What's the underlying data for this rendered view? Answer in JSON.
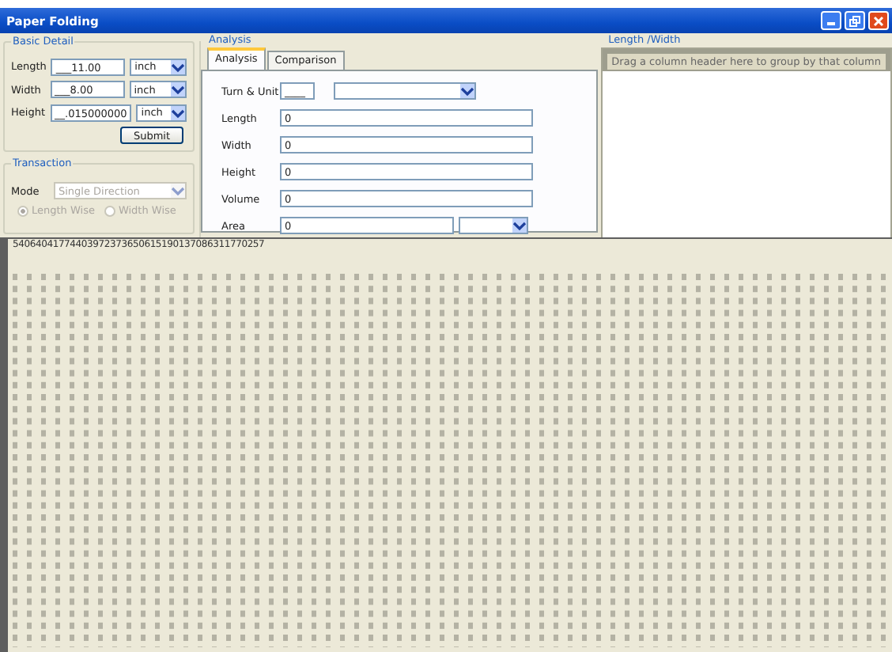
{
  "window": {
    "title": "Paper Folding"
  },
  "basic_detail": {
    "title": "Basic Detail",
    "fields": [
      {
        "label": "Length",
        "value": "___11.00",
        "unit": "inch"
      },
      {
        "label": "Width",
        "value": "___8.00",
        "unit": "inch"
      },
      {
        "label": "Height",
        "value": "__.015000000",
        "unit": "inch"
      }
    ],
    "submit": "Submit"
  },
  "transaction": {
    "title": "Transaction",
    "disabled": true,
    "mode_label": "Mode",
    "mode": "Single Direction",
    "options": [
      {
        "label": "Length Wise",
        "selected": true
      },
      {
        "label": "Width Wise",
        "selected": false
      }
    ]
  },
  "analysis": {
    "title": "Analysis",
    "tabs": [
      {
        "label": "Analysis",
        "selected": true
      },
      {
        "label": "Comparison",
        "selected": false
      }
    ],
    "turn_label": "Turn & Unit",
    "turn_value": "____",
    "fields": [
      {
        "label": "Length",
        "value": "0"
      },
      {
        "label": "Width",
        "value": "0"
      },
      {
        "label": "Height",
        "value": "0"
      },
      {
        "label": "Volume",
        "value": "0"
      },
      {
        "label": "Area",
        "value": "0",
        "kind": "unit"
      }
    ]
  },
  "length_width": {
    "title": "Length /Width",
    "group_hint": "Drag a column header here to group by that column"
  },
  "output": {
    "first_line": "54064041774403972373650615190137086311770257"
  }
}
